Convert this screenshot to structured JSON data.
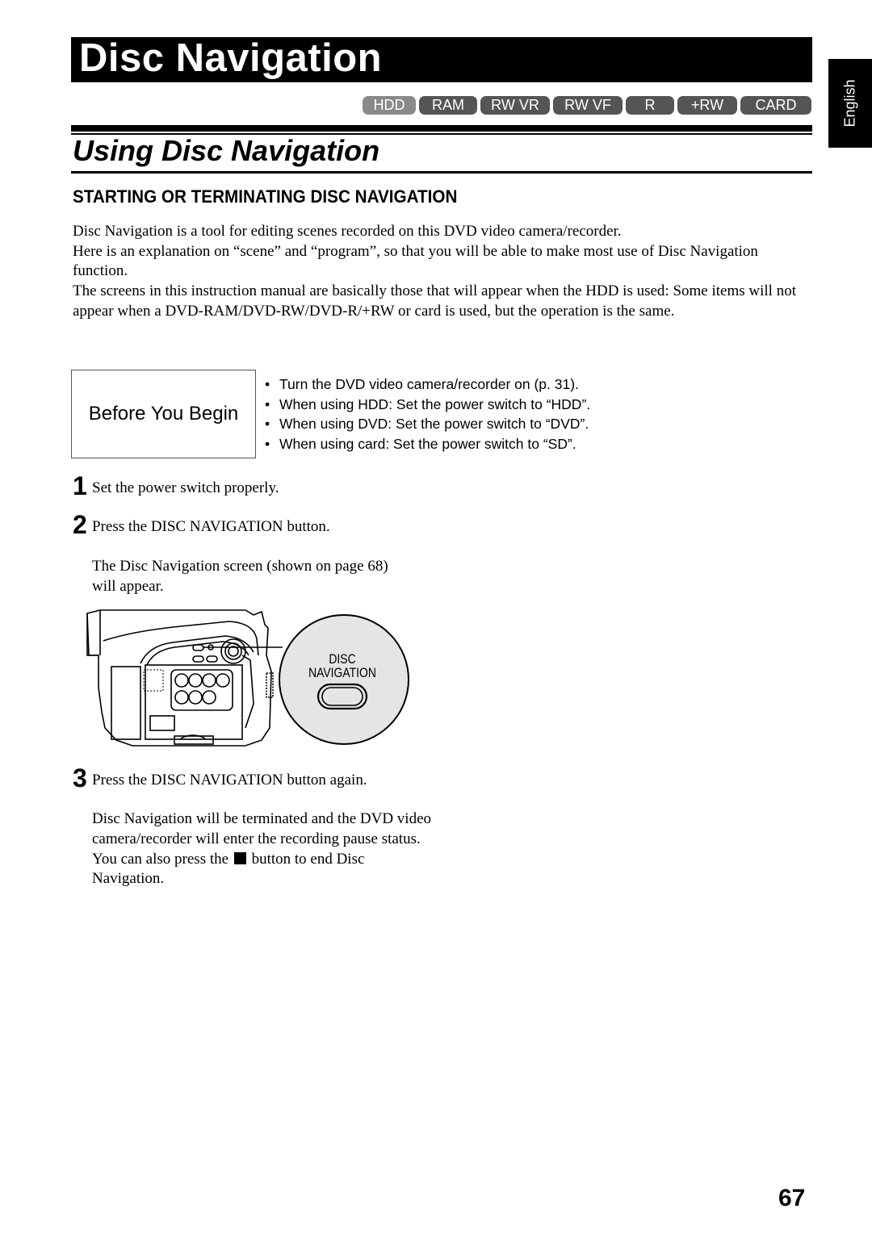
{
  "page": {
    "chapter_title": "Disc Navigation",
    "language_tab": "English",
    "media_badges": [
      {
        "label": "HDD",
        "active": true
      },
      {
        "label": "RAM",
        "active": false
      },
      {
        "label": "RW VR",
        "active": false
      },
      {
        "label": "RW VF",
        "active": false
      },
      {
        "label": "R",
        "active": false
      },
      {
        "label": "+RW",
        "active": false
      },
      {
        "label": "CARD",
        "active": false
      }
    ],
    "section_title": "Using Disc Navigation",
    "subheading": "STARTING OR TERMINATING DISC NAVIGATION",
    "intro_paragraphs": [
      "Disc Navigation is a tool for editing scenes recorded on this DVD video camera/recorder.",
      "Here is an explanation on “scene” and “program”, so that you will be able to make most use of Disc Navigation function.",
      "The screens in this instruction manual are basically those that will appear when the HDD is used: Some items will not appear when a DVD-RAM/DVD-RW/DVD-R/+RW or card is used, but the operation is the same."
    ],
    "before_you_begin": {
      "label": "Before You Begin",
      "bullet": "•",
      "items": [
        "Turn the DVD video camera/recorder on (p. 31).",
        "When using HDD: Set the power switch to “HDD”.",
        "When using DVD: Set the power switch to “DVD”.",
        "When using card: Set the power switch to “SD”."
      ]
    },
    "steps": [
      {
        "number": "1",
        "text": "Set the power switch properly."
      },
      {
        "number": "2",
        "text": "Press the DISC NAVIGATION button.",
        "detail": [
          "The Disc Navigation screen (shown on page 68) will appear."
        ]
      },
      {
        "number": "3",
        "text": "Press the DISC NAVIGATION button again.",
        "detail_before_icon": "Disc Navigation will be terminated and the DVD video camera/recorder will enter the recording pause status.",
        "detail_line2_pre": "You can also press the",
        "detail_line2_post": "button to end Disc Navigation."
      }
    ],
    "illustration": {
      "callout_line1": "DISC",
      "callout_line2": "NAVIGATION"
    },
    "page_number": "67"
  }
}
